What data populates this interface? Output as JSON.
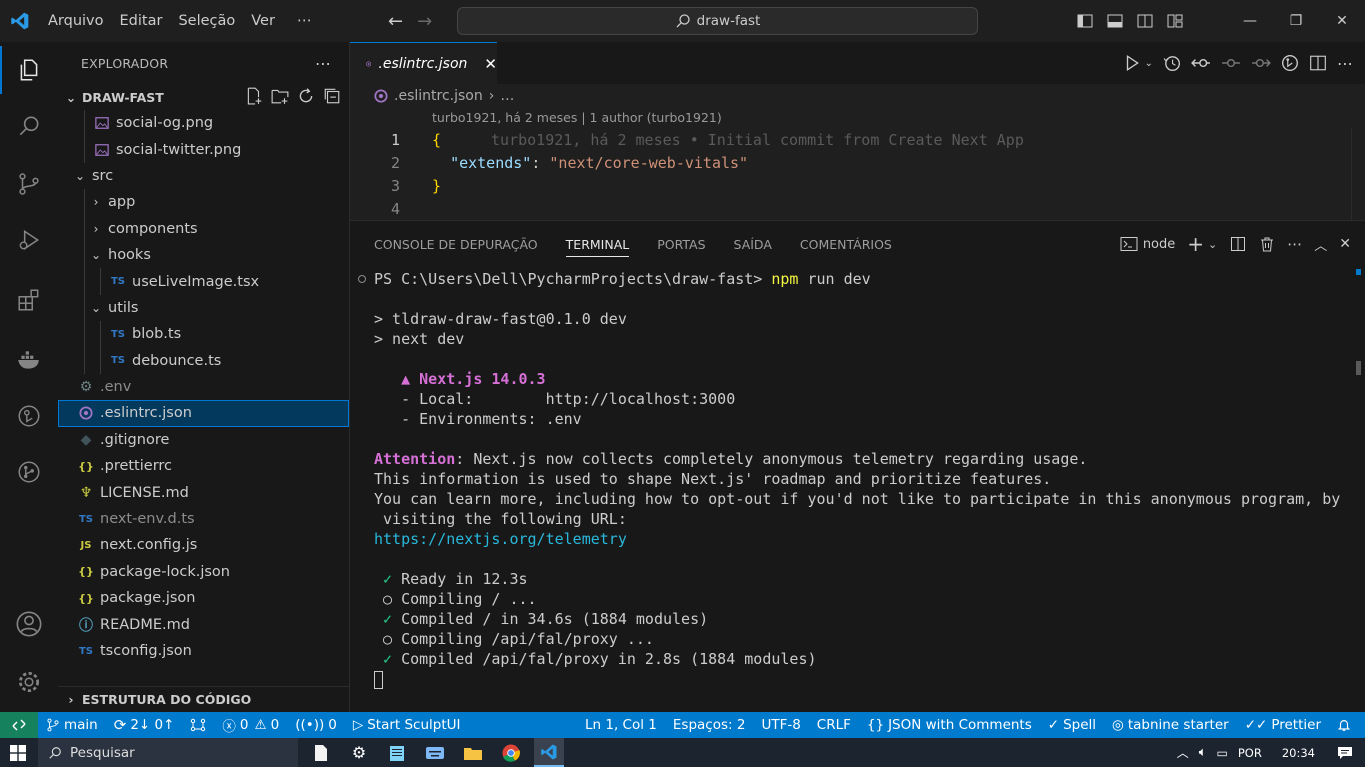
{
  "titlebar": {
    "menus": [
      "Arquivo",
      "Editar",
      "Seleção",
      "Ver",
      "⋯"
    ],
    "search": "draw-fast",
    "window_buttons": [
      "—",
      "❐",
      "✕"
    ]
  },
  "sidebar": {
    "title": "EXPLORADOR",
    "section": "DRAW-FAST",
    "bottom_section": "ESTRUTURA DO CÓDIGO",
    "items": [
      {
        "label": "social-og.png",
        "icon": "image-icon",
        "depth": 1,
        "kind": "file"
      },
      {
        "label": "social-twitter.png",
        "icon": "image-icon",
        "depth": 1,
        "kind": "file"
      },
      {
        "label": "src",
        "icon": "",
        "depth": 0,
        "kind": "folder-open"
      },
      {
        "label": "app",
        "icon": "",
        "depth": 1,
        "kind": "folder-closed"
      },
      {
        "label": "components",
        "icon": "",
        "depth": 1,
        "kind": "folder-closed"
      },
      {
        "label": "hooks",
        "icon": "",
        "depth": 1,
        "kind": "folder-open"
      },
      {
        "label": "useLiveImage.tsx",
        "icon": "TS",
        "depth": 2,
        "kind": "file"
      },
      {
        "label": "utils",
        "icon": "",
        "depth": 1,
        "kind": "folder-open"
      },
      {
        "label": "blob.ts",
        "icon": "TS",
        "depth": 2,
        "kind": "file"
      },
      {
        "label": "debounce.ts",
        "icon": "TS",
        "depth": 2,
        "kind": "file"
      },
      {
        "label": ".env",
        "icon": "gear-icon",
        "depth": 0,
        "kind": "file",
        "dim": true
      },
      {
        "label": ".eslintrc.json",
        "icon": "eslint-icon",
        "depth": 0,
        "kind": "file",
        "selected": true
      },
      {
        "label": ".gitignore",
        "icon": "git-icon",
        "depth": 0,
        "kind": "file"
      },
      {
        "label": ".prettierrc",
        "icon": "{}",
        "depth": 0,
        "kind": "file"
      },
      {
        "label": "LICENSE.md",
        "icon": "license-icon",
        "depth": 0,
        "kind": "file"
      },
      {
        "label": "next-env.d.ts",
        "icon": "TS",
        "depth": 0,
        "kind": "file",
        "dim": true
      },
      {
        "label": "next.config.js",
        "icon": "JS",
        "depth": 0,
        "kind": "file"
      },
      {
        "label": "package-lock.json",
        "icon": "{}",
        "depth": 0,
        "kind": "file"
      },
      {
        "label": "package.json",
        "icon": "{}",
        "depth": 0,
        "kind": "file"
      },
      {
        "label": "README.md",
        "icon": "info-icon",
        "depth": 0,
        "kind": "file"
      },
      {
        "label": "tsconfig.json",
        "icon": "TS",
        "depth": 0,
        "kind": "file"
      }
    ]
  },
  "editor": {
    "tab": ".eslintrc.json",
    "breadcrumb": [
      ".eslintrc.json",
      "…"
    ],
    "blame_header": "turbo1921, há 2 meses | 1 author (turbo1921)",
    "ghost": "turbo1921, há 2 meses • Initial commit from Create Next App",
    "lines": [
      {
        "n": "1",
        "parts": [
          {
            "t": "{",
            "c": "brace"
          }
        ]
      },
      {
        "n": "2",
        "parts": [
          {
            "t": "  ",
            "c": ""
          },
          {
            "t": "\"extends\"",
            "c": "key"
          },
          {
            "t": ": ",
            "c": ""
          },
          {
            "t": "\"next/core-web-vitals\"",
            "c": "str"
          }
        ]
      },
      {
        "n": "3",
        "parts": [
          {
            "t": "}",
            "c": "brace"
          }
        ]
      },
      {
        "n": "4",
        "parts": []
      }
    ]
  },
  "panel": {
    "tabs": [
      "CONSOLE DE DEPURAÇÃO",
      "TERMINAL",
      "PORTAS",
      "SAÍDA",
      "COMENTÁRIOS"
    ],
    "active_tab": "TERMINAL",
    "shell": "node",
    "terminal": [
      [
        {
          "t": "PS C:\\Users\\Dell\\PycharmProjects\\draw-fast> ",
          "c": ""
        },
        {
          "t": "npm",
          "c": "yellow"
        },
        {
          "t": " run dev",
          "c": ""
        }
      ],
      [],
      [
        {
          "t": "> tldraw-draw-fast@0.1.0 dev",
          "c": ""
        }
      ],
      [
        {
          "t": "> next dev",
          "c": ""
        }
      ],
      [],
      [
        {
          "t": "   ▲ Next.js 14.0.3",
          "c": "magenta"
        }
      ],
      [
        {
          "t": "   - Local:        http://localhost:3000",
          "c": ""
        }
      ],
      [
        {
          "t": "   - Environments: .env",
          "c": ""
        }
      ],
      [],
      [
        {
          "t": "Attention",
          "c": "magenta"
        },
        {
          "t": ": Next.js now collects completely anonymous telemetry regarding usage.",
          "c": ""
        }
      ],
      [
        {
          "t": "This information is used to shape Next.js' roadmap and prioritize features.",
          "c": ""
        }
      ],
      [
        {
          "t": "You can learn more, including how to opt-out if you'd not like to participate in this anonymous program, by",
          "c": ""
        }
      ],
      [
        {
          "t": " visiting the following URL:",
          "c": ""
        }
      ],
      [
        {
          "t": "https://nextjs.org/telemetry",
          "c": "cyan"
        }
      ],
      [],
      [
        {
          "t": " ✓",
          "c": "green"
        },
        {
          "t": " Ready in 12.3s",
          "c": ""
        }
      ],
      [
        {
          "t": " ○ Compiling / ...",
          "c": ""
        }
      ],
      [
        {
          "t": " ✓",
          "c": "green"
        },
        {
          "t": " Compiled / in 34.6s (1884 modules)",
          "c": ""
        }
      ],
      [
        {
          "t": " ○ Compiling /api/fal/proxy ...",
          "c": ""
        }
      ],
      [
        {
          "t": " ✓",
          "c": "green"
        },
        {
          "t": " Compiled /api/fal/proxy in 2.8s (1884 modules)",
          "c": ""
        }
      ]
    ]
  },
  "statusbar": {
    "branch": "main",
    "sync": "2↓ 0↑",
    "errors": "0",
    "warnings": "0",
    "ports": "0",
    "sculpt": "Start SculptUI",
    "position": "Ln 1, Col 1",
    "spaces": "Espaços: 2",
    "encoding": "UTF-8",
    "eol": "CRLF",
    "language": "JSON with Comments",
    "spell": "Spell",
    "tabnine": "tabnine starter",
    "prettier": "Prettier"
  },
  "taskbar": {
    "search": "Pesquisar",
    "lang": "POR",
    "time": "20:34"
  },
  "colors": {
    "accent": "#007acc",
    "remote": "#16825d",
    "selection": "#04395e"
  }
}
